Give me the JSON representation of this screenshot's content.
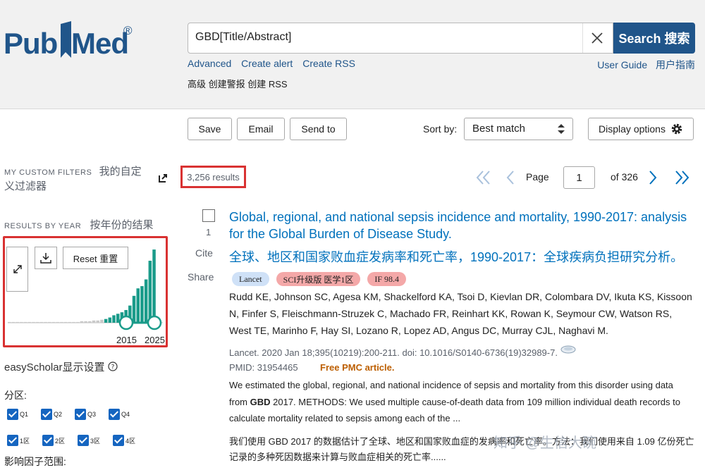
{
  "header": {
    "logo_text_a": "Pub",
    "logo_text_b": "Med",
    "logo_reg": "®",
    "search_value": "GBD[Title/Abstract]",
    "search_button": "Search 搜索",
    "links_left": [
      "Advanced",
      "Create alert",
      "Create RSS"
    ],
    "links_right": [
      "User Guide",
      "用户指南"
    ],
    "links_cn": "高级 创建警报 创建 RSS"
  },
  "actions": {
    "save": "Save",
    "email": "Email",
    "send_to": "Send to",
    "sort_label": "Sort by:",
    "sort_value": "Best match",
    "display_options": "Display options"
  },
  "sidebar": {
    "custom_filters_en": "MY CUSTOM FILTERS",
    "custom_filters_cn": "我的自定义过滤器",
    "results_by_year_en": "RESULTS BY YEAR",
    "results_by_year_cn": "按年份的结果",
    "reset": "Reset 重置",
    "year_start": "2015",
    "year_end": "2025",
    "easyscholar": "easyScholar显示设置",
    "zone_label": "分区:",
    "q_items": [
      "Q1",
      "Q2",
      "Q3",
      "Q4"
    ],
    "cn_items": [
      "1区",
      "2区",
      "3区",
      "4区"
    ],
    "if_range": "影响因子范围:"
  },
  "chart_data": {
    "type": "bar",
    "title": "",
    "x_range": [
      1990,
      2025
    ],
    "values_relative": [
      0.01,
      0.01,
      0.01,
      0.01,
      0.01,
      0.01,
      0.01,
      0.01,
      0.01,
      0.01,
      0.01,
      0.01,
      0.01,
      0.01,
      0.01,
      0.01,
      0.01,
      0.01,
      0.02,
      0.02,
      0.02,
      0.03,
      0.03,
      0.04,
      0.05,
      0.07,
      0.1,
      0.12,
      0.14,
      0.17,
      0.23,
      0.36,
      0.46,
      0.49,
      0.58,
      0.83,
      0.98
    ],
    "selected_range": [
      "2015",
      "2025"
    ]
  },
  "results": {
    "count": "3,256 results",
    "page_label": "Page",
    "page_value": "1",
    "of_pages": "of 326"
  },
  "article": {
    "number": "1",
    "cite": "Cite",
    "share": "Share",
    "title": "Global, regional, and national sepsis incidence and mortality, 1990-2017: analysis for the Global Burden of Disease Study.",
    "title_cn": "全球、地区和国家败血症发病率和死亡率，1990-2017：全球疾病负担研究分析。",
    "tags": [
      {
        "text": "Lancet",
        "bg": "#cfe1f7"
      },
      {
        "text": "SCI升级版 医学1区",
        "bg": "#f4a8a8"
      },
      {
        "text": "IF 98.4",
        "bg": "#f4a8a8"
      }
    ],
    "authors": "Rudd KE, Johnson SC, Agesa KM, Shackelford KA, Tsoi D, Kievlan DR, Colombara DV, Ikuta KS, Kissoon N, Finfer S, Fleischmann-Struzek C, Machado FR, Reinhart KK, Rowan K, Seymour CW, Watson RS, West TE, Marinho F, Hay SI, Lozano R, Lopez AD, Angus DC, Murray CJL, Naghavi M.",
    "journal": "Lancet. 2020 Jan 18;395(10219):200-211. doi: 10.1016/S0140-6736(19)32989-7.",
    "pmid": "PMID: 31954465",
    "pmc": "Free PMC article.",
    "abstract_a": "We estimated the global, regional, and national incidence of sepsis and mortality from this disorder using data from ",
    "abstract_bold": "GBD",
    "abstract_b": " 2017. METHODS: We used multiple cause-of-death data from 109 million individual death records to calculate mortality related to sepsis among each of the ...",
    "abstract_cn": "我们使用 GBD 2017 的数据估计了全球、地区和国家败血症的发病率和死亡率。方法：我们使用来自 1.09 亿份死亡记录的多种死因数据来计算与败血症相关的死亡率......"
  },
  "watermark": "知乎 @生信大碗",
  "colors": {
    "brand": "#20558a",
    "link": "#0071bc",
    "highlight_border": "#d93232",
    "bar": "#1a9b8a"
  }
}
